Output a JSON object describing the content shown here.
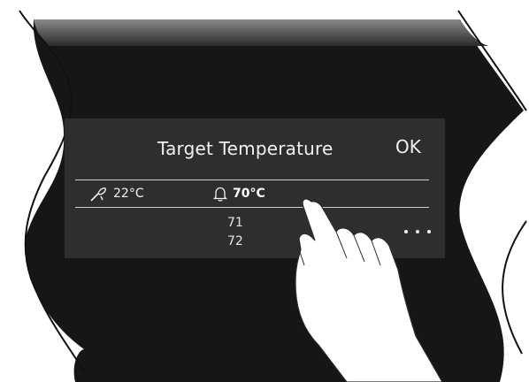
{
  "screen": {
    "title": "Target Temperature",
    "ok_label": "OK",
    "probe": {
      "icon": "probe-icon",
      "value": "22°C"
    },
    "target": {
      "icon": "bell-icon",
      "value": "70°C"
    },
    "picker": {
      "options": [
        "71",
        "72"
      ]
    },
    "more": {
      "icon": "ellipsis-icon"
    }
  },
  "colors": {
    "screen_bg": "#2e2e2e",
    "device_body": "#161616",
    "device_top": "#6a6a6a",
    "text": "#f2f2f2"
  }
}
